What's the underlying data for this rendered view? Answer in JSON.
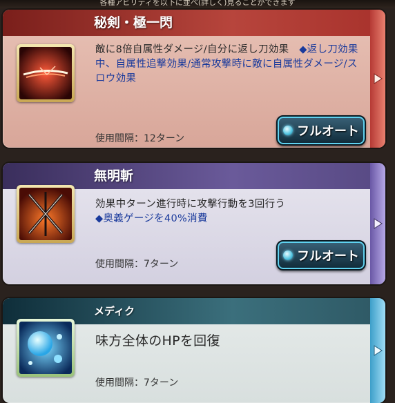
{
  "top_strip": "各種アビリティを以下に並べ(詳しく)見ることができます",
  "skills": [
    {
      "name": "秘剣・極一閃",
      "desc_plain": "敵に8倍自属性ダメージ/自分に返し刀効果　",
      "desc_buff": "◆返し刀効果中、自属性追撃効果/通常攻撃時に敵に自属性ダメージ/スロウ効果",
      "interval": "使用間隔：12ターン",
      "auto_label": "フルオート",
      "icon": "slash-skill-icon"
    },
    {
      "name": "無明斬",
      "desc_plain": "効果中ターン進行時に攻撃行動を3回行う",
      "desc_buff": "◆奥義ゲージを40%消費",
      "interval": "使用間隔：7ターン",
      "auto_label": "フルオート",
      "icon": "crossed-swords-icon"
    },
    {
      "name": "メディク",
      "desc_plain": "味方全体のHPを回復",
      "interval": "使用間隔：7ターン",
      "icon": "heal-orb-icon"
    }
  ],
  "colors": {
    "red_header": "#a8322c",
    "purple_header": "#574983",
    "teal_header": "#2e5864",
    "buff_text": "#1a3a9c",
    "auto_button_glow": "#5fd2f0"
  }
}
